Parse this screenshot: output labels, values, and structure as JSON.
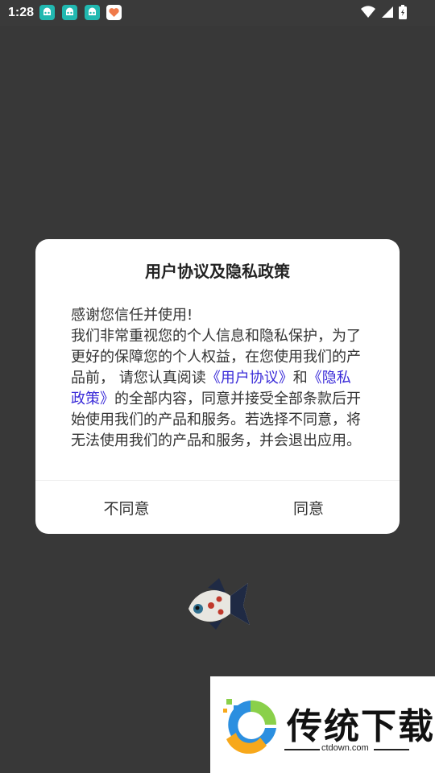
{
  "status_bar": {
    "time": "1:28"
  },
  "dialog": {
    "title": "用户协议及隐私政策",
    "body": {
      "line1": "感谢您信任并使用!",
      "para_before_links": "我们非常重视您的个人信息和隐私保护，为了更好的保障您的个人权益，在您使用我们的产品前， 请您认真阅读",
      "link_user_agreement": "《用户协议》",
      "and": "和",
      "link_privacy_policy": "《隐私政策》",
      "para_after_links": "的全部内容，同意并接受全部条款后开始使用我们的产品和服务。若选择不同意，将无法使用我们的产品和服务，并会退出应用。"
    },
    "buttons": {
      "disagree": "不同意",
      "agree": "同意"
    }
  },
  "watermark": {
    "text": "传统下载",
    "url": "ctdown.com"
  },
  "colors": {
    "link": "#3a2bd8",
    "background": "#383838",
    "app_icon": "#21b8b0"
  }
}
